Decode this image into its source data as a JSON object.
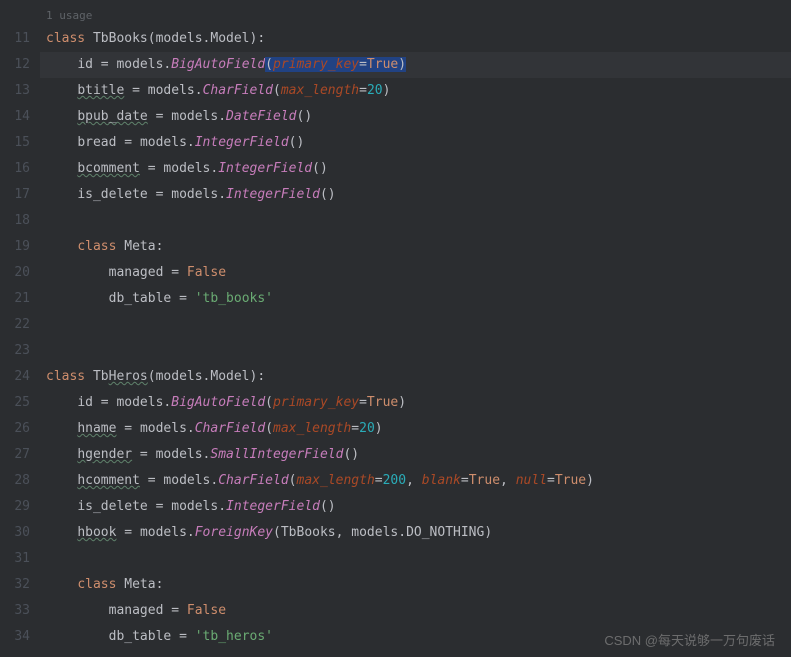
{
  "usage_hint": "1 usage",
  "line_numbers": [
    "11",
    "12",
    "13",
    "14",
    "15",
    "16",
    "17",
    "18",
    "19",
    "20",
    "21",
    "22",
    "23",
    "24",
    "25",
    "26",
    "27",
    "28",
    "29",
    "30",
    "31",
    "32",
    "33",
    "34"
  ],
  "code": {
    "l11": {
      "kw": "class",
      "cls": "TbBooks",
      "base": "models.Model"
    },
    "l12": {
      "attr": "id",
      "mod": "models.",
      "fn": "BigAutoField",
      "p1": "primary_key",
      "v1": "True"
    },
    "l13": {
      "attr": "btitle",
      "mod": "models.",
      "fn": "CharField",
      "p1": "max_length",
      "v1": "20"
    },
    "l14": {
      "attr": "bpub_date",
      "mod": "models.",
      "fn": "DateField"
    },
    "l15": {
      "attr": "bread",
      "mod": "models.",
      "fn": "IntegerField"
    },
    "l16": {
      "attr": "bcomment",
      "mod": "models.",
      "fn": "IntegerField"
    },
    "l17": {
      "attr": "is_delete",
      "mod": "models.",
      "fn": "IntegerField"
    },
    "l19": {
      "kw": "class",
      "cls": "Meta"
    },
    "l20": {
      "attr": "managed",
      "val": "False"
    },
    "l21": {
      "attr": "db_table",
      "val": "'tb_books'"
    },
    "l24": {
      "kw": "class",
      "cls": "TbHeros",
      "base": "models.Model"
    },
    "l25": {
      "attr": "id",
      "mod": "models.",
      "fn": "BigAutoField",
      "p1": "primary_key",
      "v1": "True"
    },
    "l26": {
      "attr": "hname",
      "mod": "models.",
      "fn": "CharField",
      "p1": "max_length",
      "v1": "20"
    },
    "l27": {
      "attr": "hgender",
      "mod": "models.",
      "fn": "SmallIntegerField"
    },
    "l28": {
      "attr": "hcomment",
      "mod": "models.",
      "fn": "CharField",
      "p1": "max_length",
      "v1": "200",
      "p2": "blank",
      "v2": "True",
      "p3": "null",
      "v3": "True"
    },
    "l29": {
      "attr": "is_delete",
      "mod": "models.",
      "fn": "IntegerField"
    },
    "l30": {
      "attr": "hbook",
      "mod": "models.",
      "fn": "ForeignKey",
      "args": "TbBooks, models.DO_NOTHING"
    },
    "l32": {
      "kw": "class",
      "cls": "Meta"
    },
    "l33": {
      "attr": "managed",
      "val": "False"
    },
    "l34": {
      "attr": "db_table",
      "val": "'tb_heros'"
    }
  },
  "watermark": "CSDN @每天说够一万句废话",
  "chart_data": null
}
